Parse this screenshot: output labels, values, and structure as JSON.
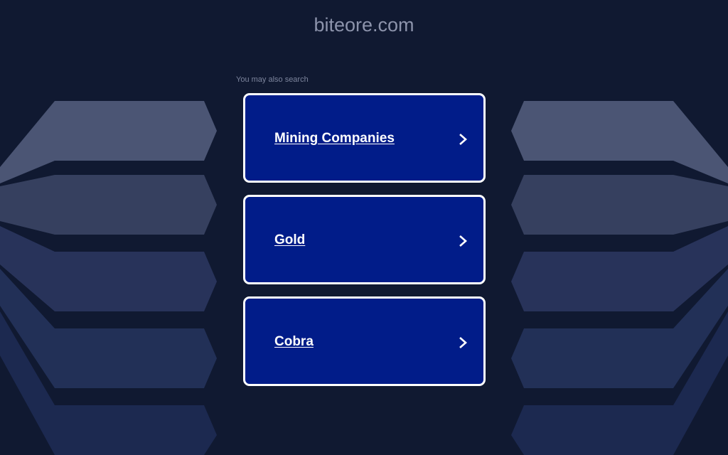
{
  "header": {
    "domain": "biteore.com"
  },
  "search_hint": "You may also search",
  "links": [
    {
      "label": "Mining Companies",
      "icon": "chevron-right-icon"
    },
    {
      "label": "Gold",
      "icon": "chevron-right-icon"
    },
    {
      "label": "Cobra",
      "icon": "chevron-right-icon"
    }
  ],
  "colors": {
    "background": "#101931",
    "card": "#011c89",
    "card_border": "#ffffff",
    "title_text": "#8c93ab"
  }
}
